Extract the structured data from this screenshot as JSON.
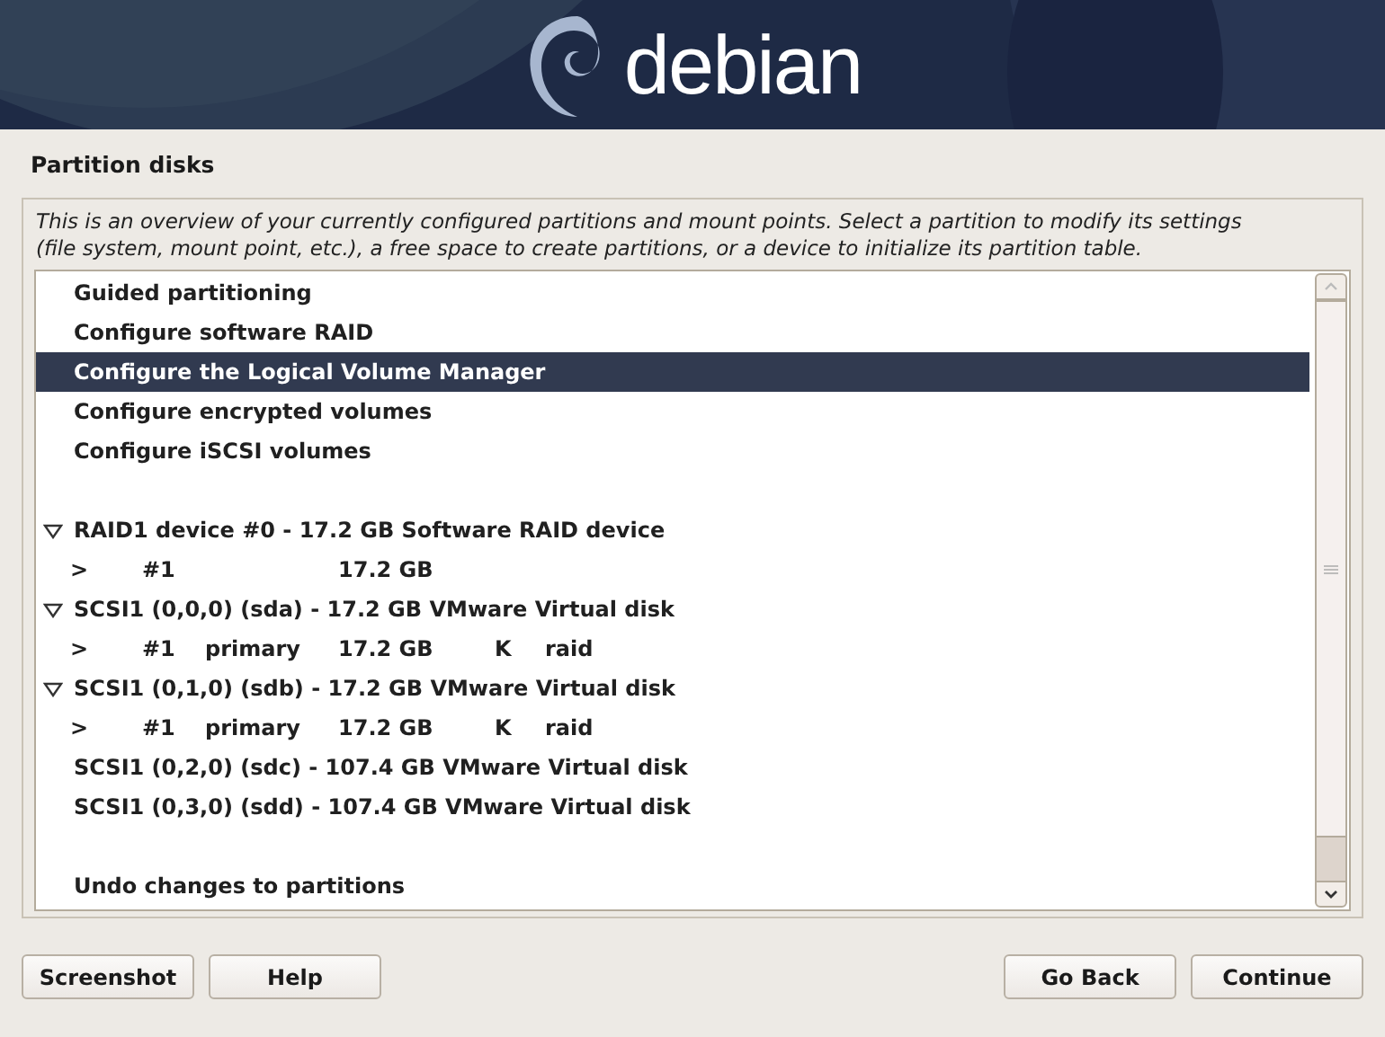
{
  "header": {
    "logo_text": "debian"
  },
  "title": "Partition disks",
  "description": "This is an overview of your currently configured partitions and mount points. Select a partition to modify its settings (file system, mount point, etc.), a free space to create partitions, or a device to initialize its partition table.",
  "list": {
    "items": [
      {
        "kind": "action",
        "text": "Guided partitioning",
        "selected": false
      },
      {
        "kind": "action",
        "text": "Configure software RAID",
        "selected": false
      },
      {
        "kind": "action",
        "text": "Configure the Logical Volume Manager",
        "selected": true
      },
      {
        "kind": "action",
        "text": "Configure encrypted volumes",
        "selected": false
      },
      {
        "kind": "action",
        "text": "Configure iSCSI volumes",
        "selected": false
      },
      {
        "kind": "spacer"
      },
      {
        "kind": "device",
        "text": "RAID1 device #0 - 17.2 GB Software RAID device",
        "expanded": true,
        "selected": false
      },
      {
        "kind": "partition",
        "marker": ">",
        "number": "#1",
        "size": "17.2 GB",
        "selected": false
      },
      {
        "kind": "device",
        "text": "SCSI1 (0,0,0) (sda) - 17.2 GB VMware Virtual disk",
        "expanded": true,
        "selected": false
      },
      {
        "kind": "partition",
        "marker": ">",
        "number": "#1",
        "type": "primary",
        "size": "17.2 GB",
        "flag": "K",
        "use": "raid",
        "selected": false
      },
      {
        "kind": "device",
        "text": "SCSI1 (0,1,0) (sdb) - 17.2 GB VMware Virtual disk",
        "expanded": true,
        "selected": false
      },
      {
        "kind": "partition",
        "marker": ">",
        "number": "#1",
        "type": "primary",
        "size": "17.2 GB",
        "flag": "K",
        "use": "raid",
        "selected": false
      },
      {
        "kind": "disk",
        "text": "SCSI1 (0,2,0) (sdc) - 107.4 GB VMware Virtual disk",
        "selected": false
      },
      {
        "kind": "disk",
        "text": "SCSI1 (0,3,0) (sdd) - 107.4 GB VMware Virtual disk",
        "selected": false
      },
      {
        "kind": "spacer"
      },
      {
        "kind": "action",
        "text": "Undo changes to partitions",
        "selected": false
      }
    ]
  },
  "buttons_left": [
    "Screenshot",
    "Help"
  ],
  "buttons_right": [
    "Go Back",
    "Continue"
  ]
}
